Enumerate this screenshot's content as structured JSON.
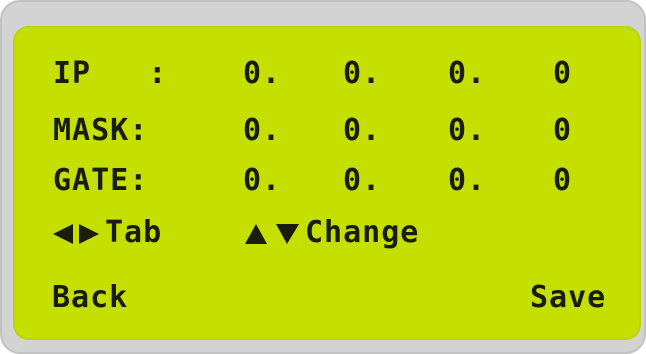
{
  "rows": [
    {
      "label": "IP   :",
      "octets": [
        "0.",
        "0.",
        "0.",
        "0"
      ]
    },
    {
      "label": "MASK:",
      "octets": [
        "0.",
        "0.",
        "0.",
        "0"
      ]
    },
    {
      "label": "GATE:",
      "octets": [
        "0.",
        "0.",
        "0.",
        "0"
      ]
    }
  ],
  "hints": {
    "tab_label": "Tab",
    "change_label": "Change",
    "tab_icon": "left-right-arrows-icon",
    "change_icon": "up-down-arrows-icon"
  },
  "softkeys": {
    "back_label": "Back",
    "save_label": "Save"
  },
  "colors": {
    "lcd_background": "#c5e000",
    "lcd_text": "#1a1d0d",
    "bezel": "#d3d3d3"
  }
}
